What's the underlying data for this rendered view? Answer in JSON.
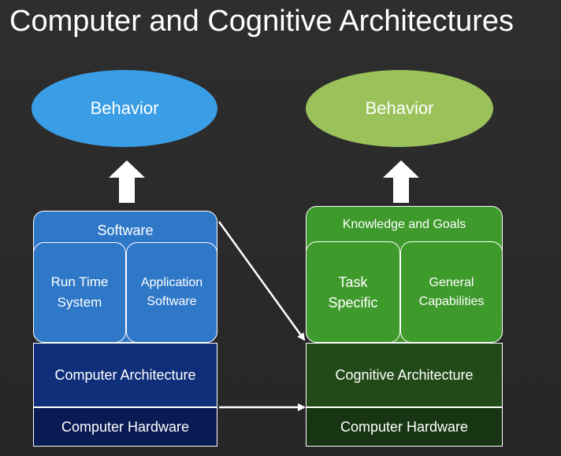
{
  "title": "Computer and Cognitive Architectures",
  "left": {
    "behavior": "Behavior",
    "software": "Software",
    "run_time": "Run Time\nSystem",
    "application": "Application\nSoftware",
    "architecture": "Computer Architecture",
    "hardware": "Computer Hardware",
    "colors": {
      "ellipse": "#3a9ee6",
      "software": "#2f78c8",
      "architecture": "#0f2f7a",
      "hardware": "#0a1a52"
    }
  },
  "right": {
    "behavior": "Behavior",
    "knowledge": "Knowledge and Goals",
    "task": "Task\nSpecific",
    "general": "General\nCapabilities",
    "architecture": "Cognitive Architecture",
    "hardware": "Computer Hardware",
    "colors": {
      "ellipse": "#9bc25a",
      "knowledge": "#3f9a2c",
      "architecture": "#224a18",
      "hardware": "#173512"
    }
  }
}
